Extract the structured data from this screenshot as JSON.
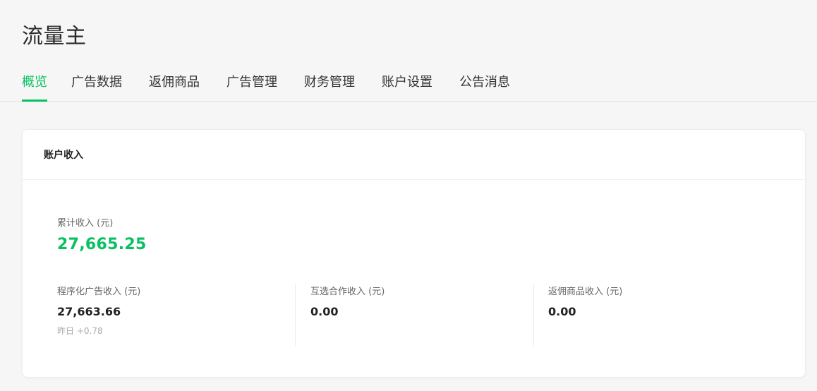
{
  "page": {
    "title": "流量主"
  },
  "tabs": [
    {
      "label": "概览",
      "active": true
    },
    {
      "label": "广告数据",
      "active": false
    },
    {
      "label": "返佣商品",
      "active": false
    },
    {
      "label": "广告管理",
      "active": false
    },
    {
      "label": "财务管理",
      "active": false
    },
    {
      "label": "账户设置",
      "active": false
    },
    {
      "label": "公告消息",
      "active": false
    }
  ],
  "account_income": {
    "title": "账户收入",
    "total": {
      "label": "累计收入 (元)",
      "value": "27,665.25"
    },
    "breakdown": [
      {
        "label": "程序化广告收入 (元)",
        "value": "27,663.66",
        "sub": "昨日 +0.78"
      },
      {
        "label": "互选合作收入 (元)",
        "value": "0.00"
      },
      {
        "label": "返佣商品收入 (元)",
        "value": "0.00"
      }
    ]
  },
  "colors": {
    "accent": "#07c160",
    "background": "#f6f6f6",
    "card": "#ffffff"
  }
}
